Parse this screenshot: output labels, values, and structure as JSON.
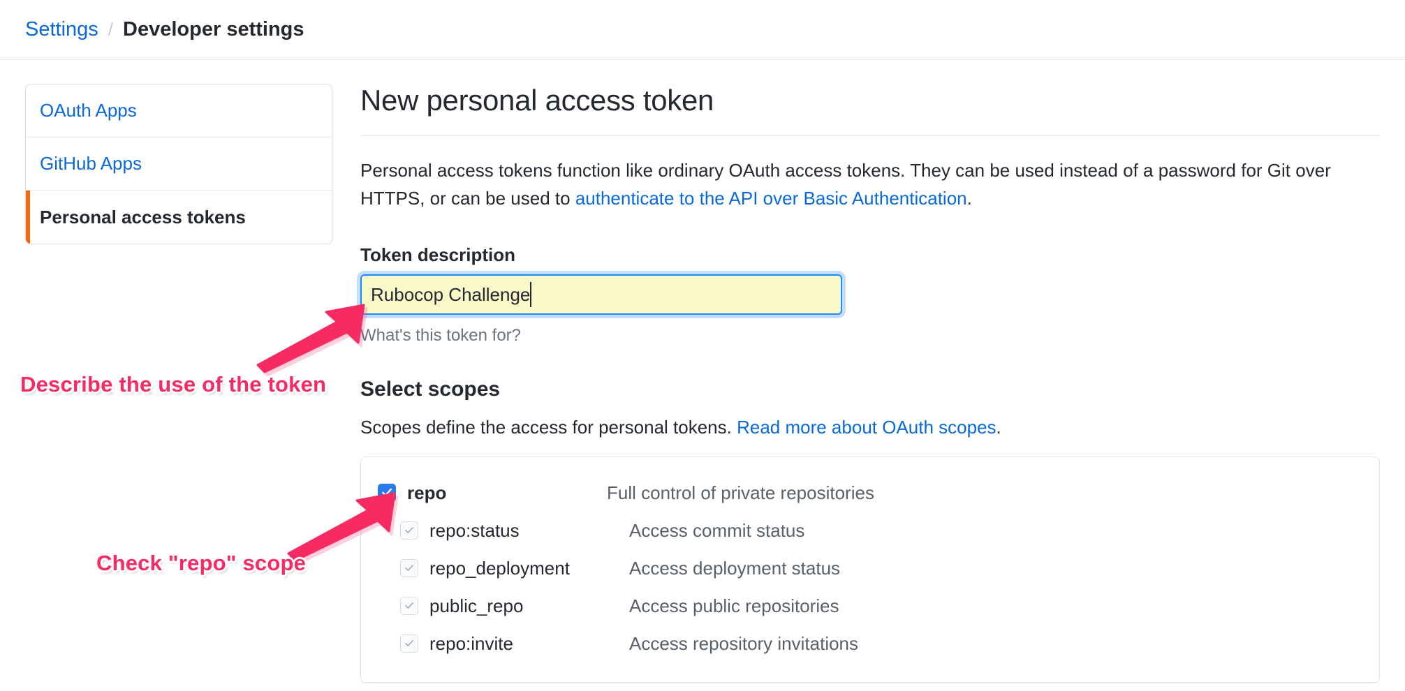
{
  "breadcrumb": {
    "root_label": "Settings",
    "separator": "/",
    "current_label": "Developer settings"
  },
  "sidebar": {
    "items": [
      {
        "label": "OAuth Apps",
        "active": false
      },
      {
        "label": "GitHub Apps",
        "active": false
      },
      {
        "label": "Personal access tokens",
        "active": true
      }
    ]
  },
  "main": {
    "title": "New personal access token",
    "intro": {
      "text_before": "Personal access tokens function like ordinary OAuth access tokens. They can be used instead of a password for Git over HTTPS, or can be used to ",
      "link_label": "authenticate to the API over Basic Authentication",
      "text_after": "."
    },
    "token_description": {
      "label": "Token description",
      "value": "Rubocop Challenge",
      "placeholder": "",
      "hint": "What's this token for?"
    },
    "scopes": {
      "title": "Select scopes",
      "desc_before": "Scopes define the access for personal tokens. ",
      "desc_link": "Read more about OAuth scopes",
      "desc_after": ".",
      "rows": [
        {
          "name": "repo",
          "description": "Full control of private repositories",
          "checked": true,
          "disabled": false,
          "child": false
        },
        {
          "name": "repo:status",
          "description": "Access commit status",
          "checked": true,
          "disabled": true,
          "child": true
        },
        {
          "name": "repo_deployment",
          "description": "Access deployment status",
          "checked": true,
          "disabled": true,
          "child": true
        },
        {
          "name": "public_repo",
          "description": "Access public repositories",
          "checked": true,
          "disabled": true,
          "child": true
        },
        {
          "name": "repo:invite",
          "description": "Access repository invitations",
          "checked": true,
          "disabled": true,
          "child": true
        }
      ]
    }
  },
  "annotations": [
    {
      "id": "describe",
      "text": "Describe the use of the token"
    },
    {
      "id": "check-repo",
      "text": "Check \"repo\" scope"
    }
  ],
  "colors": {
    "link": "#0969da",
    "annotation": "#f72a62",
    "active_indicator": "#f66a0a",
    "checkbox_checked": "#2a7aef",
    "input_autofill": "#f8f8c9",
    "input_focus_border": "#1a8cff"
  }
}
